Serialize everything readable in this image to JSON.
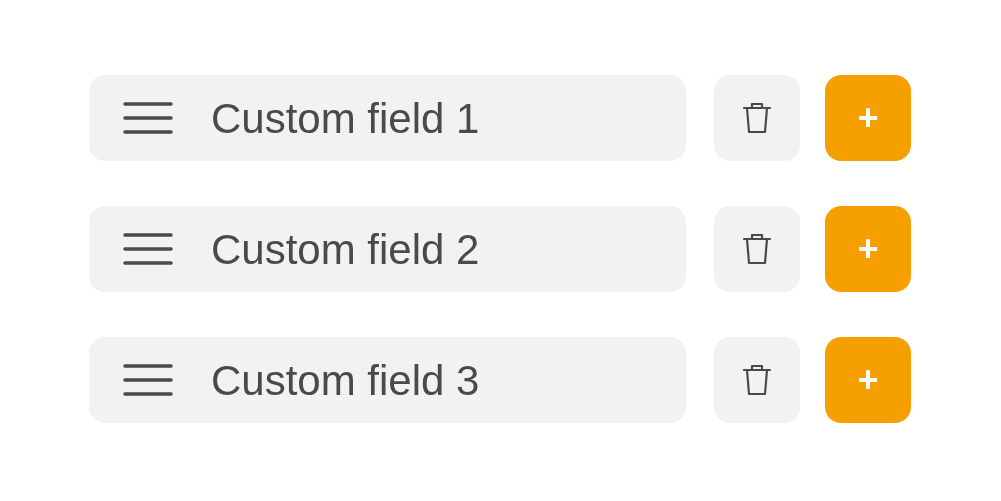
{
  "rows": [
    {
      "label": "Custom field 1",
      "add": "+"
    },
    {
      "label": "Custom field 2",
      "add": "+"
    },
    {
      "label": "Custom field 3",
      "add": "+"
    }
  ]
}
